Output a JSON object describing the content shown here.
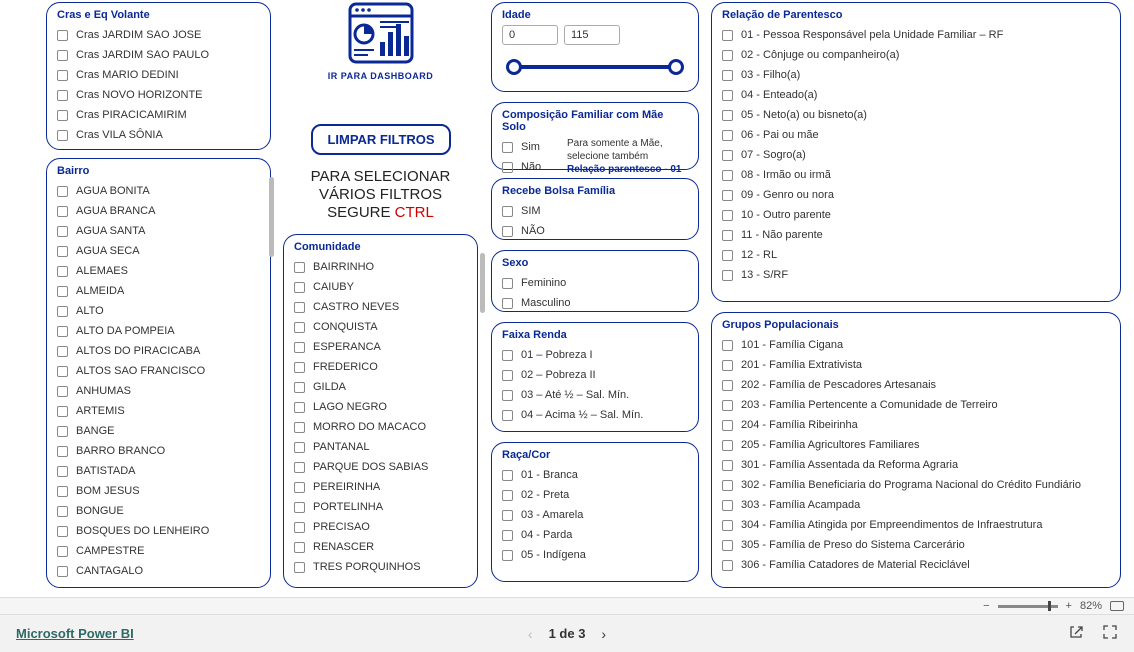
{
  "cras": {
    "title": "Cras e Eq Volante",
    "items": [
      "Cras JARDIM SAO JOSE",
      "Cras JARDIM SAO PAULO",
      "Cras MARIO DEDINI",
      "Cras NOVO HORIZONTE",
      "Cras PIRACICAMIRIM",
      "Cras VILA SÔNIA"
    ]
  },
  "bairro": {
    "title": "Bairro",
    "items": [
      "AGUA BONITA",
      "AGUA BRANCA",
      "AGUA SANTA",
      "AGUA SECA",
      "ALEMAES",
      "ALMEIDA",
      "ALTO",
      "ALTO DA POMPEIA",
      "ALTOS DO PIRACICABA",
      "ALTOS SAO FRANCISCO",
      "ANHUMAS",
      "ARTEMIS",
      "BANGE",
      "BARRO BRANCO",
      "BATISTADA",
      "BOM JESUS",
      "BONGUE",
      "BOSQUES DO LENHEIRO",
      "CAMPESTRE",
      "CANTAGALO"
    ]
  },
  "dashboard": {
    "caption": "IR PARA DASHBOARD"
  },
  "clear_btn": "LIMPAR FILTROS",
  "hint": {
    "l1": "PARA SELECIONAR",
    "l2": "VÁRIOS FILTROS",
    "l3": "SEGURE ",
    "ctrl": "CTRL"
  },
  "comunidade": {
    "title": "Comunidade",
    "items": [
      "BAIRRINHO",
      "CAIUBY",
      "CASTRO NEVES",
      "CONQUISTA",
      "ESPERANCA",
      "FREDERICO",
      "GILDA",
      "LAGO NEGRO",
      "MORRO DO MACACO",
      "PANTANAL",
      "PARQUE DOS SABIAS",
      "PEREIRINHA",
      "PORTELINHA",
      "PRECISAO",
      "RENASCER",
      "TRES PORQUINHOS"
    ]
  },
  "idade": {
    "title": "Idade",
    "min": "0",
    "max": "115"
  },
  "mae_solo": {
    "title": "Composição Familiar com Mãe Solo",
    "items": [
      "Sim",
      "Não"
    ],
    "note1": "Para somente a Mãe, selecione também",
    "note2": "Relação parentesco - 01"
  },
  "bolsa": {
    "title": "Recebe Bolsa Família",
    "items": [
      "SIM",
      "NÃO"
    ]
  },
  "sexo": {
    "title": "Sexo",
    "items": [
      "Feminino",
      "Masculino"
    ]
  },
  "renda": {
    "title": "Faixa Renda",
    "items": [
      "01 – Pobreza I",
      "02 – Pobreza II",
      "03 – Até ½ – Sal. Mín.",
      "04 – Acima ½ – Sal. Mín."
    ]
  },
  "raca": {
    "title": "Raça/Cor",
    "items": [
      "01 - Branca",
      "02 - Preta",
      "03 - Amarela",
      "04 - Parda",
      "05 - Indígena"
    ]
  },
  "parentesco": {
    "title": "Relação de Parentesco",
    "items": [
      "01 - Pessoa Responsável pela Unidade Familiar – RF",
      "02 - Cônjuge ou companheiro(a)",
      "03 - Filho(a)",
      "04 - Enteado(a)",
      "05 - Neto(a) ou bisneto(a)",
      "06 - Pai ou mãe",
      "07 - Sogro(a)",
      "08 - Irmão ou irmã",
      "09 - Genro ou nora",
      "10 - Outro parente",
      "11 - Não parente",
      "12 - RL",
      "13 - S/RF"
    ]
  },
  "grupos": {
    "title": "Grupos Populacionais",
    "items": [
      "101 - Família Cigana",
      "201 - Família Extrativista",
      "202 - Família de Pescadores Artesanais",
      "203 - Família Pertencente a Comunidade de Terreiro",
      "204 - Família Ribeirinha",
      "205 - Família Agricultores Familiares",
      "301 - Família Assentada da Reforma Agraria",
      "302 - Família Beneficiaria do Programa Nacional do Crédito Fundiário",
      "303 - Família Acampada",
      "304 - Família Atingida por Empreendimentos de Infraestrutura",
      "305 - Família de Preso do Sistema Carcerário",
      "306 - Família Catadores de Material Reciclável"
    ]
  },
  "zoom": {
    "value": "82%"
  },
  "footer": {
    "brand": "Microsoft Power BI",
    "page": "1 de 3"
  }
}
